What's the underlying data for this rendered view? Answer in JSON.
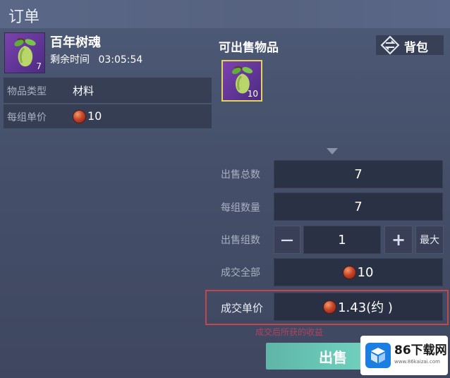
{
  "window": {
    "title": "订单"
  },
  "item": {
    "name": "百年树魂",
    "time_label": "剩余时间",
    "time_value": "03:05:54",
    "slot_count": "7",
    "type_label": "物品类型",
    "type_value": "材料",
    "unit_price_label": "每组单价",
    "unit_price_value": "10"
  },
  "sellable": {
    "title": "可出售物品",
    "bag_label": "背包",
    "slot_count": "10"
  },
  "form": {
    "total_label": "出售总数",
    "total_value": "7",
    "per_group_label": "每组数量",
    "per_group_value": "7",
    "groups_label": "出售组数",
    "groups_value": "1",
    "minus": "—",
    "plus": "+",
    "max_label": "最大",
    "deal_total_label": "成交全部",
    "deal_total_value": "10",
    "deal_unit_label": "成交单价",
    "deal_unit_value": "1.43(约 )",
    "warning": "成交后所获的收益"
  },
  "sell_button": "出售",
  "watermark": {
    "brand": "86下载网",
    "url": "www.86kaizai.com"
  },
  "colors": {
    "highlight_border": "#c2464e",
    "warning_text": "#d0405e",
    "slot_border_selected": "#e6d35a"
  }
}
